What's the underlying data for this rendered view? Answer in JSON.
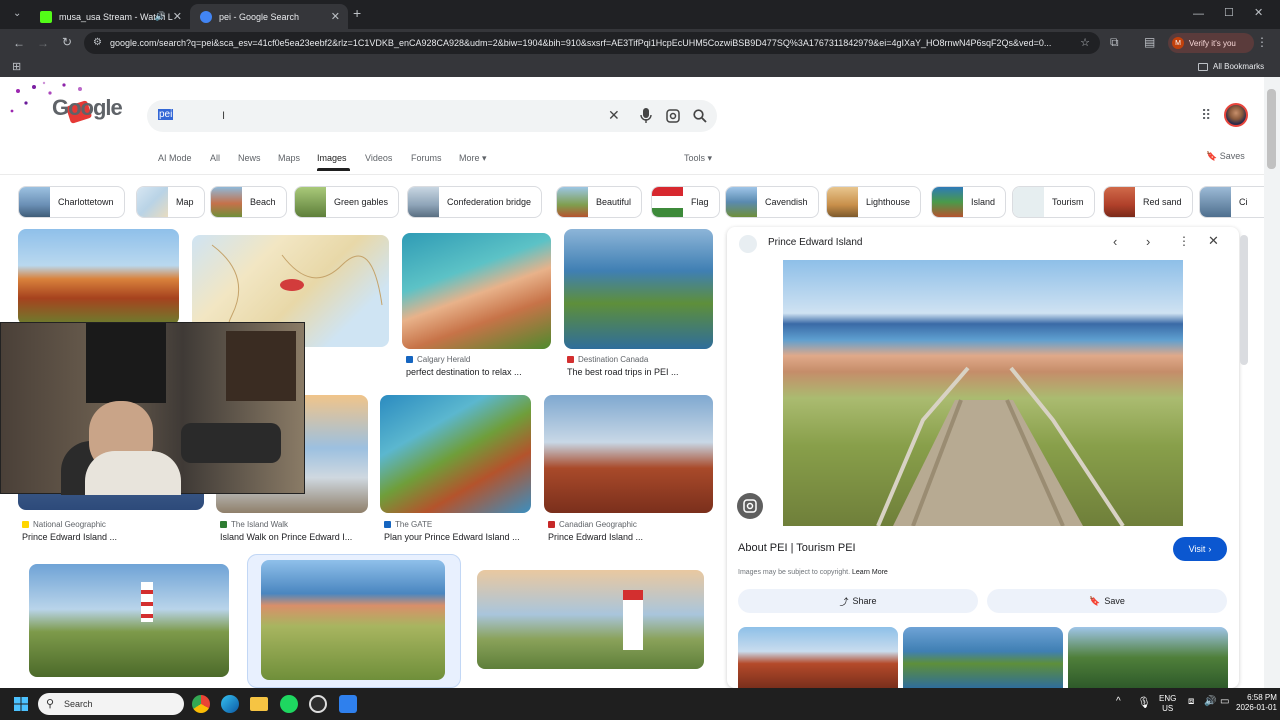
{
  "browser": {
    "tabs": [
      {
        "title": "musa_usa Stream - Watch L",
        "favicon_color": "#53fc18",
        "active": false
      },
      {
        "title": "pei - Google Search",
        "favicon_color": "#4285f4",
        "active": true
      }
    ],
    "new_tab_symbol": "+",
    "url": "google.com/search?q=pei&sca_esv=41cf0e5ea23eebf2&rlz=1C1VDKB_enCA928CA928&udm=2&biw=1904&bih=910&sxsrf=AE3TifPqi1HcpEcUHM5CozwiBSB9D477SQ%3A1767311842979&ei=4gIXaY_HO8rnwN4P6sqF2Qs&ved=0...",
    "verify_label": "Verify it's you",
    "profile_letter": "M",
    "all_bookmarks": "All Bookmarks"
  },
  "google": {
    "logo_text": "Google",
    "search_value": "pei",
    "nav_tabs": [
      "AI Mode",
      "All",
      "News",
      "Maps",
      "Images",
      "Videos",
      "Forums",
      "More"
    ],
    "active_tab": "Images",
    "tools_label": "Tools",
    "saves_label": "Saves",
    "chips": [
      {
        "label": "Charlottetown",
        "color": "#6a8fb5"
      },
      {
        "label": "Map",
        "color": "#b9d3e6"
      },
      {
        "label": "Beach",
        "color": "#c5714a"
      },
      {
        "label": "Green gables",
        "color": "#5e7f3a"
      },
      {
        "label": "Confederation bridge",
        "color": "#8ea4b8"
      },
      {
        "label": "Beautiful",
        "color": "#7f9e4e"
      },
      {
        "label": "Flag",
        "color": "#d7282f"
      },
      {
        "label": "Cavendish",
        "color": "#5a8ab0"
      },
      {
        "label": "Lighthouse",
        "color": "#c88f4a"
      },
      {
        "label": "Island",
        "color": "#2e7ab8"
      },
      {
        "label": "Tourism",
        "color": "#e6eef0"
      },
      {
        "label": "Red sand",
        "color": "#b0402a"
      },
      {
        "label": "Ci",
        "color": "#4e6f8e"
      }
    ],
    "results": [
      {
        "source": "Calgary Herald",
        "caption": "perfect destination to relax ...",
        "source_color": "#1565c0"
      },
      {
        "source": "Destination Canada",
        "caption": "The best road trips in PEI ...",
        "source_color": "#d32f2f"
      },
      {
        "source": "National Geographic",
        "caption": "Prince Edward Island ...",
        "source_color": "#ffd600"
      },
      {
        "source": "The Island Walk",
        "caption": "Island Walk on Prince Edward I...",
        "source_color": "#2e7d32"
      },
      {
        "source": "The GATE",
        "caption": "Plan your Prince Edward Island ...",
        "source_color": "#1565c0"
      },
      {
        "source": "Canadian Geographic",
        "caption": "Prince Edward Island ...",
        "source_color": "#c62828"
      }
    ]
  },
  "panel": {
    "title": "Prince Edward Island",
    "headline": "About PEI | Tourism PEI",
    "visit_label": "Visit",
    "copyright_text": "Images may be subject to copyright.",
    "learn_more": "Learn More",
    "share_label": "Share",
    "save_label": "Save"
  },
  "taskbar": {
    "search_placeholder": "Search",
    "lang_top": "ENG",
    "lang_bottom": "US",
    "time": "6:58 PM",
    "date": "2026-01-01"
  }
}
